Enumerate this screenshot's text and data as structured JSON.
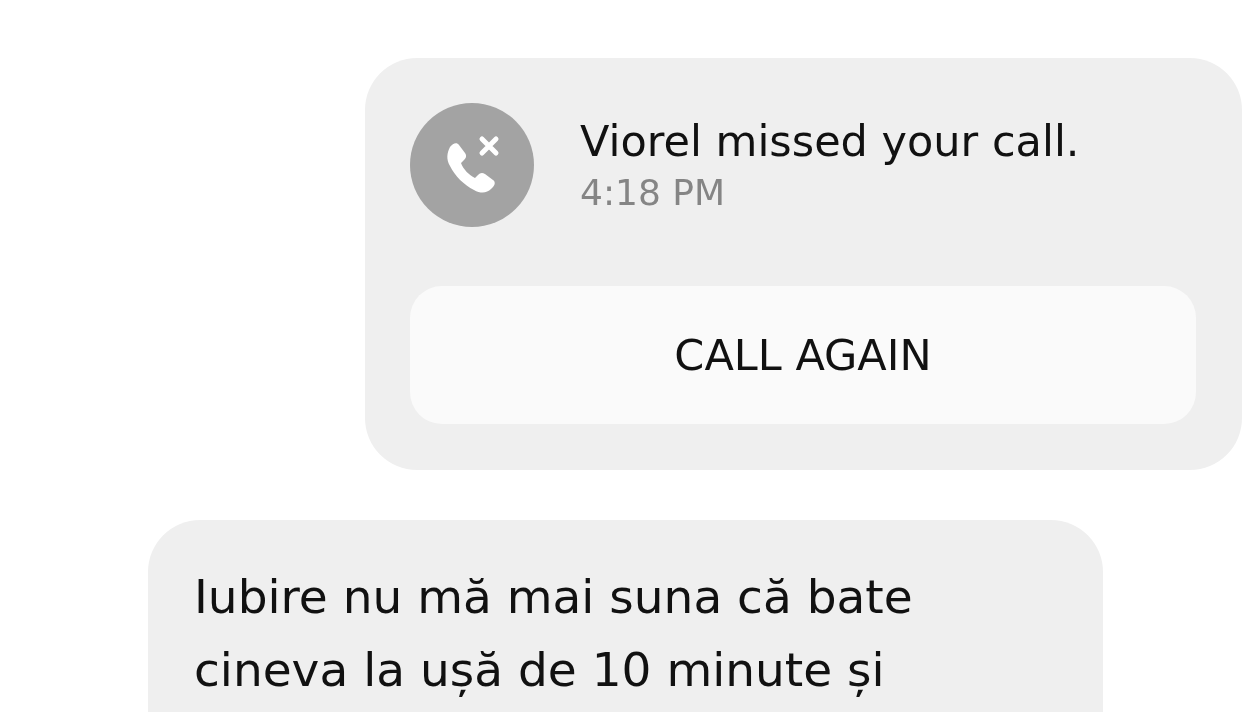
{
  "missed_call_card": {
    "message": "Viorel missed your call.",
    "time": "4:18 PM",
    "button": "CALL AGAIN"
  },
  "message_bubble": {
    "text": "Iubire nu mă mai suna că bate cineva la ușă de 10 minute și"
  }
}
